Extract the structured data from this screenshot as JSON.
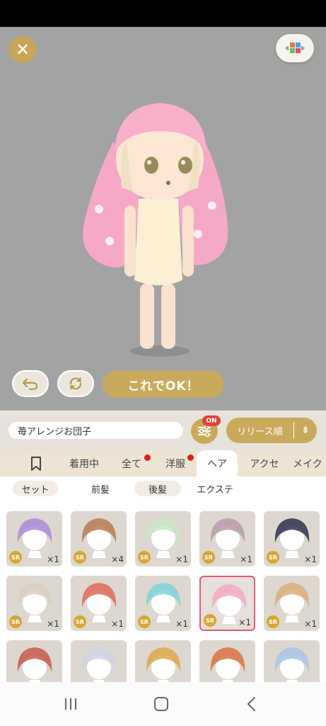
{
  "toolbar": {
    "ok_label": "これでOK！"
  },
  "controls": {
    "name_value": "苺アレンジお団子",
    "filter_badge": "ON",
    "sort_label": "リリース順"
  },
  "tabs": [
    {
      "label": "着用中"
    },
    {
      "label": "全て"
    },
    {
      "label": "洋服"
    },
    {
      "label": "ヘア"
    },
    {
      "label": "アクセ"
    },
    {
      "label": "メイク"
    }
  ],
  "subtabs": [
    {
      "label": "セット"
    },
    {
      "label": "前髪"
    },
    {
      "label": "後髪"
    },
    {
      "label": "エクステ"
    }
  ],
  "items": [
    {
      "rarity": "SR",
      "qty": "×1",
      "hair": "#a98ad9"
    },
    {
      "rarity": "SR",
      "qty": "×4",
      "hair": "#b77a50"
    },
    {
      "rarity": "SR",
      "qty": "×1",
      "hair": "#c9e6c5"
    },
    {
      "rarity": "SR",
      "qty": "×1",
      "hair": "#b99aaa"
    },
    {
      "rarity": "SR",
      "qty": "×1",
      "hair": "#2f3350"
    },
    {
      "rarity": "SR",
      "qty": "×1",
      "hair": "#d9cfc2"
    },
    {
      "rarity": "SR",
      "qty": "×1",
      "hair": "#e06a5a"
    },
    {
      "rarity": "SR",
      "qty": "×1",
      "hair": "#7fd5d9"
    },
    {
      "rarity": "SR",
      "qty": "×1",
      "hair": "#f4a9c3"
    },
    {
      "rarity": "SR",
      "qty": "×1",
      "hair": "#d9b07a"
    },
    {
      "rarity": "",
      "qty": "",
      "hair": "#c75a4a"
    },
    {
      "rarity": "",
      "qty": "",
      "hair": "#cfd3e6"
    },
    {
      "rarity": "",
      "qty": "",
      "hair": "#e0a84a"
    },
    {
      "rarity": "",
      "qty": "",
      "hair": "#d9733f"
    },
    {
      "rarity": "",
      "qty": "",
      "hair": "#a9c4e6"
    }
  ],
  "colors": {
    "accent": "#c9a95c",
    "stage": "#a3a3a3",
    "badge_red": "#e01b1b",
    "selected_border": "#e45a78"
  }
}
